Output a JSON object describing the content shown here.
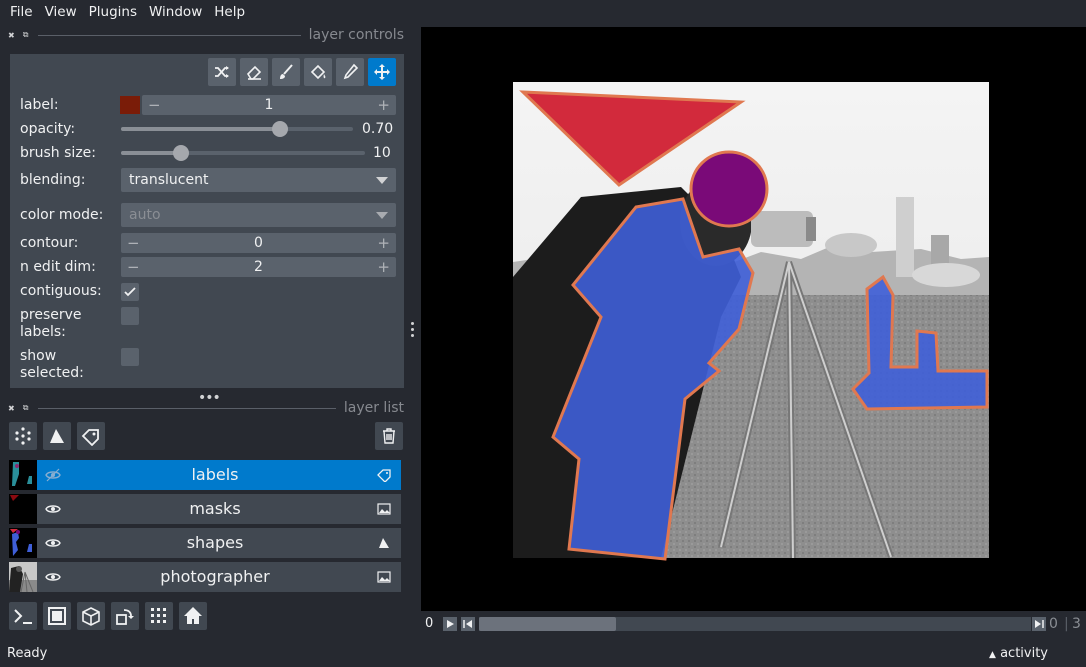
{
  "menu": [
    "File",
    "View",
    "Plugins",
    "Window",
    "Help"
  ],
  "dock": {
    "controls_title": "layer controls",
    "list_title": "layer list"
  },
  "controls": {
    "label_label": "label:",
    "label_value": "1",
    "label_color": "#7a1c08",
    "opacity_label": "opacity:",
    "opacity_value": "0.70",
    "opacity_level": 0.7,
    "brush_label": "brush size:",
    "brush_value": "10",
    "blending_label": "blending:",
    "blending_value": "translucent",
    "colormode_label": "color mode:",
    "colormode_value": "auto",
    "contour_label": "contour:",
    "contour_value": "0",
    "nedit_label": "n edit dim:",
    "nedit_value": "2",
    "contiguous_label": "contiguous:",
    "contiguous_checked": true,
    "preserve_label_1": "preserve",
    "preserve_label_2": "labels:",
    "preserve_checked": false,
    "show_label_1": "show",
    "show_label_2": "selected:",
    "show_checked": false,
    "tools": [
      "shuffle-icon",
      "eraser-icon",
      "paintbrush-icon",
      "fill-bucket-icon",
      "color-picker-icon",
      "pan-zoom-icon"
    ],
    "active_tool": "pan-zoom-icon"
  },
  "layers": [
    {
      "name": "labels",
      "type": "labels",
      "selected": true,
      "visible": true
    },
    {
      "name": "masks",
      "type": "image",
      "selected": false,
      "visible": true
    },
    {
      "name": "shapes",
      "type": "shapes",
      "selected": false,
      "visible": true
    },
    {
      "name": "photographer",
      "type": "image",
      "selected": false,
      "visible": true
    }
  ],
  "dims": {
    "start": "0",
    "current": "0",
    "total": "3"
  },
  "status": {
    "left": "Ready",
    "activity": "activity"
  },
  "colors": {
    "accent": "#007acc",
    "shape_fill": "#d22a3c",
    "circle_fill": "#7a0a78",
    "labels_fill": "#3f5fd8",
    "edge": "#e07850"
  }
}
